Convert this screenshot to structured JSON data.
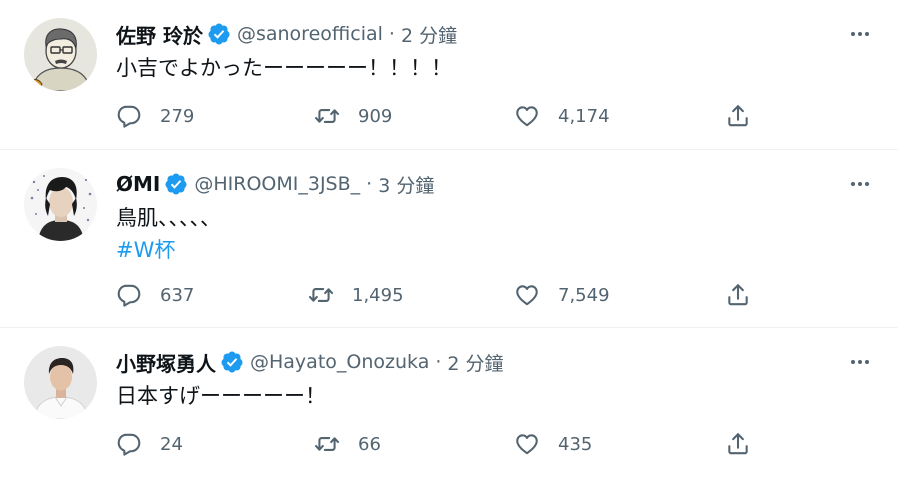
{
  "colors": {
    "text_primary": "#0f1419",
    "text_secondary": "#536471",
    "accent": "#1d9bf0",
    "divider": "#eff3f4"
  },
  "tweets": [
    {
      "name": "佐野 玲於",
      "handle": "@sanoreofficial",
      "separator": "·",
      "time": "2 分鐘",
      "text": "小吉でよかったーーーーー！！！！",
      "hashtag": "",
      "replies": "279",
      "retweets": "909",
      "likes": "4,174",
      "icons": {
        "avatar": "cartoon-avatar",
        "verified": "verified-badge-icon",
        "more": "more-icon",
        "reply": "reply-icon",
        "retweet": "retweet-icon",
        "like": "heart-icon",
        "share": "share-icon"
      }
    },
    {
      "name": "ØMI",
      "handle": "@HIROOMI_3JSB_",
      "separator": "·",
      "time": "3 分鐘",
      "text": "鳥肌、、、、、",
      "hashtag": "#W杯",
      "replies": "637",
      "retweets": "1,495",
      "likes": "7,549",
      "icons": {
        "avatar": "portrait-avatar",
        "verified": "verified-badge-icon",
        "more": "more-icon",
        "reply": "reply-icon",
        "retweet": "retweet-icon",
        "like": "heart-icon",
        "share": "share-icon"
      }
    },
    {
      "name": "小野塚勇人",
      "handle": "@Hayato_Onozuka",
      "separator": "·",
      "time": "2 分鐘",
      "text": "日本すげーーーーー！",
      "hashtag": "",
      "replies": "24",
      "retweets": "66",
      "likes": "435",
      "icons": {
        "avatar": "photo-avatar",
        "verified": "verified-badge-icon",
        "more": "more-icon",
        "reply": "reply-icon",
        "retweet": "retweet-icon",
        "like": "heart-icon",
        "share": "share-icon"
      }
    }
  ]
}
